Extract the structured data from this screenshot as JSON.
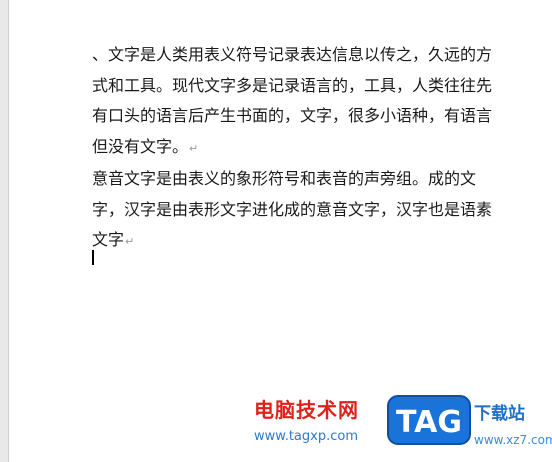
{
  "document": {
    "paragraphs": [
      {
        "text": "、文字是人类用表义符号记录表达信息以传之，久远的方式和工具。现代文字多是记录语言的，工具，人类往往先有口头的语言后产生书面的，文字，很多小语种，有语言但没有文字。",
        "mark": "↵"
      },
      {
        "text": "意音文字是由表义的象形符号和表音的声旁组。成的文字，汉字是由表形文字进化成的意音文字，汉字也是语素文字",
        "mark": "↵"
      }
    ]
  },
  "watermark": {
    "title": "电脑技术网",
    "url": "www.tagxp.com",
    "badge": "TAG",
    "right_title": "下载站",
    "right_url": "www.xz7.com"
  },
  "colors": {
    "watermark_red": "#e0201a",
    "watermark_blue": "#1f6fc4",
    "badge_blue": "#1a73d9"
  }
}
